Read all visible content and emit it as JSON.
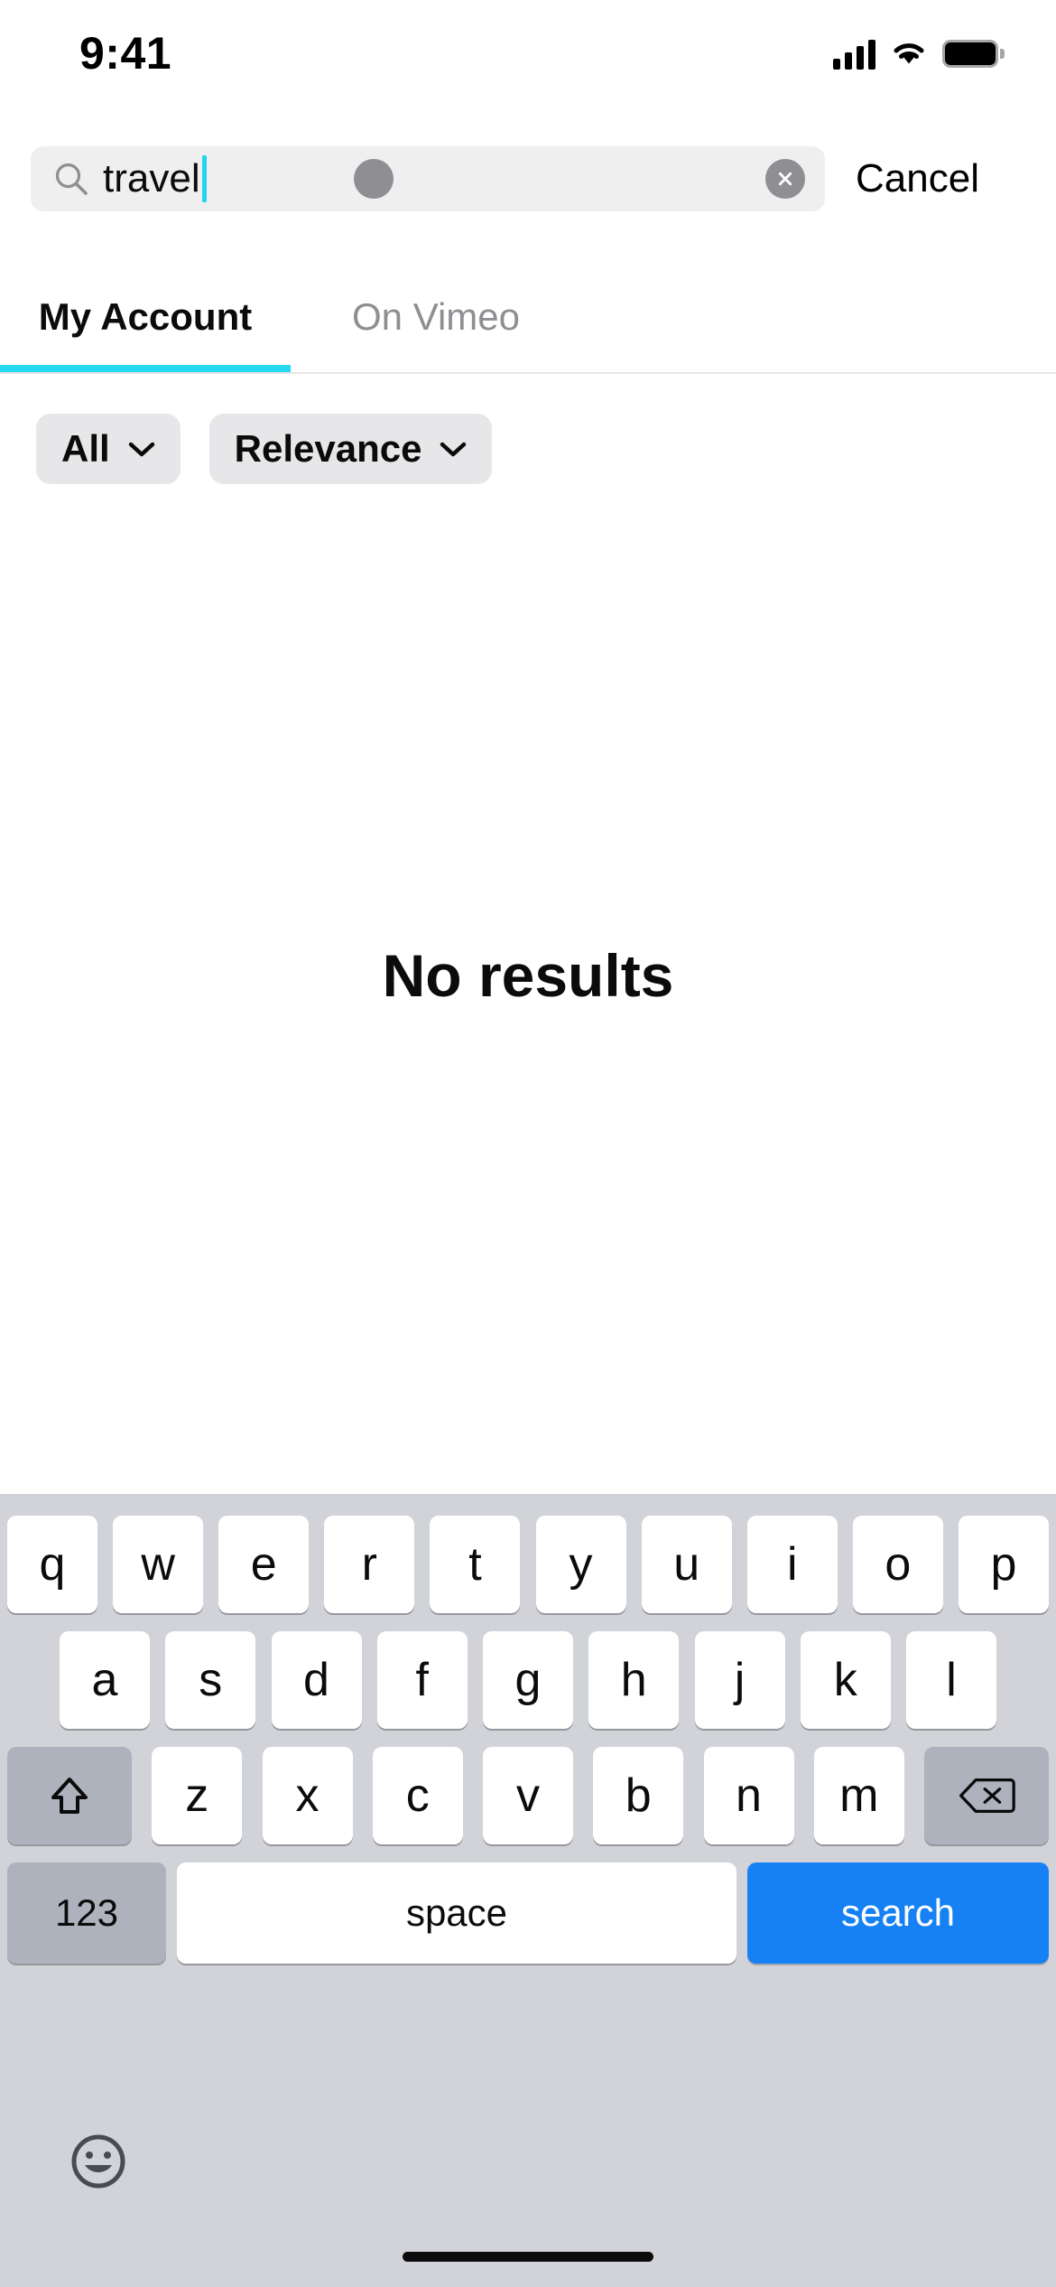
{
  "status_bar": {
    "time": "9:41",
    "icons": {
      "cellular": "signal-bars-icon",
      "wifi": "wifi-icon",
      "battery": "battery-icon"
    }
  },
  "search": {
    "icon": "search-icon",
    "value": "travel",
    "placeholder": "Search",
    "clear_icon": "close-circle-icon",
    "touch_indicator": "touch-pointer-dot",
    "cancel_label": "Cancel",
    "caret_color": "#22D3EE"
  },
  "tabs": {
    "items": [
      {
        "label": "My Account",
        "active": true
      },
      {
        "label": "On Vimeo",
        "active": false
      }
    ],
    "indicator_color": "#27D9F0"
  },
  "filters": [
    {
      "label": "All",
      "icon": "chevron-down-icon"
    },
    {
      "label": "Relevance",
      "icon": "chevron-down-icon"
    }
  ],
  "empty_state": {
    "title": "No results"
  },
  "keyboard": {
    "row1": [
      "q",
      "w",
      "e",
      "r",
      "t",
      "y",
      "u",
      "i",
      "o",
      "p"
    ],
    "row2": [
      "a",
      "s",
      "d",
      "f",
      "g",
      "h",
      "j",
      "k",
      "l"
    ],
    "row3": [
      "z",
      "x",
      "c",
      "v",
      "b",
      "n",
      "m"
    ],
    "shift_icon": "shift-up-arrow-icon",
    "backspace_icon": "backspace-delete-icon",
    "numbers_label": "123",
    "space_label": "space",
    "return_label": "search",
    "emoji_icon": "emoji-smiley-icon",
    "return_color": "#1581F4"
  },
  "home_indicator": "home-indicator-bar"
}
